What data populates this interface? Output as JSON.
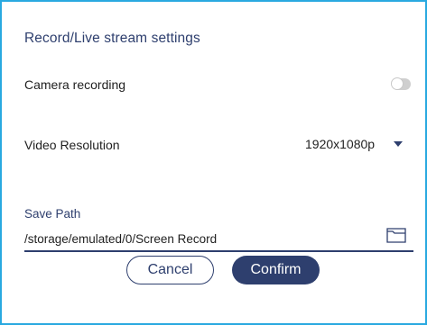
{
  "dialog": {
    "title": "Record/Live stream settings",
    "camera_recording": {
      "label": "Camera recording",
      "enabled": false
    },
    "video_resolution": {
      "label": "Video Resolution",
      "value": "1920x1080p"
    },
    "save_path": {
      "label": "Save Path",
      "value": "/storage/emulated/0/Screen Record"
    },
    "buttons": {
      "cancel": "Cancel",
      "confirm": "Confirm"
    }
  },
  "colors": {
    "border": "#29a9e0",
    "accent": "#2e3f6e",
    "toggle_off": "#cfcfcf"
  },
  "icons": {
    "dropdown": "chevron-down-icon",
    "folder": "folder-icon"
  }
}
